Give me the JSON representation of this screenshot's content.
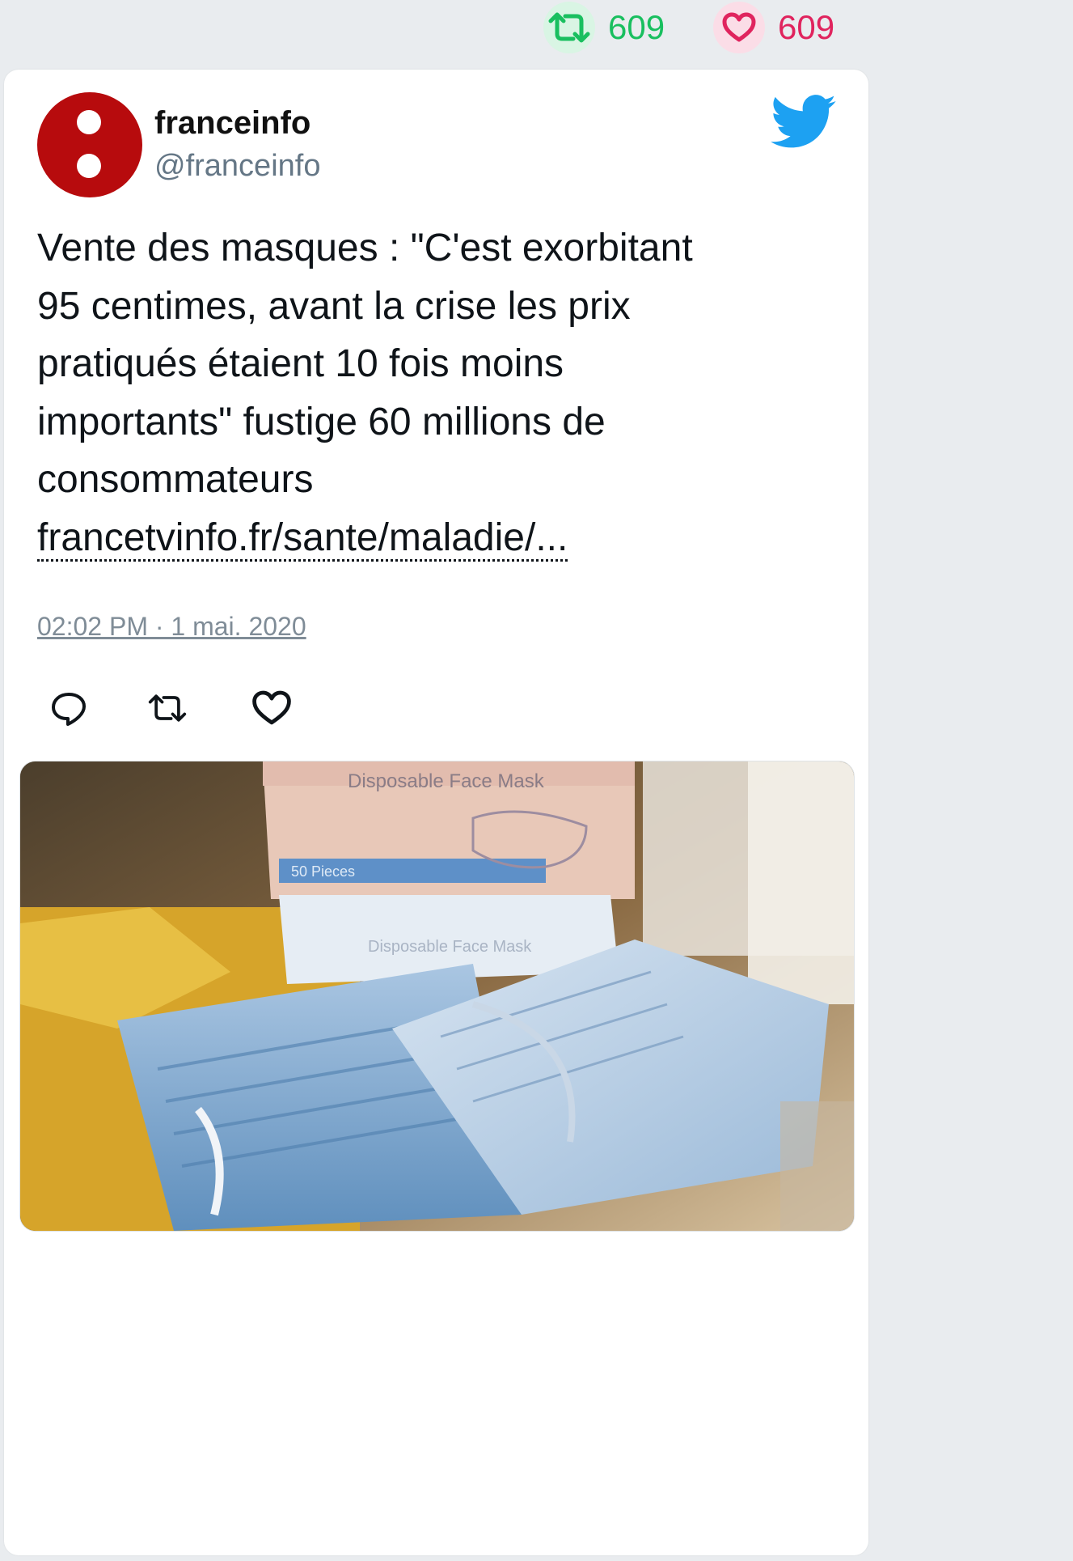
{
  "stats": {
    "retweets": "609",
    "likes": "609",
    "colors": {
      "retweet": "#19bf5f",
      "like": "#e0245e"
    }
  },
  "tweet": {
    "author_name": "franceinfo",
    "author_handle": "@franceinfo",
    "avatar_color": "#b70b0d",
    "text_lines": [
      "Vente des masques : \"C'est exorbitant",
      "95 centimes, avant la crise les prix",
      "pratiqués étaient 10 fois moins",
      "importants\" fustige 60 millions de",
      "consommateurs"
    ],
    "link_text": "francetvinfo.fr/sante/maladie/...",
    "timestamp": "02:02 PM · 1 mai. 2020",
    "icons": {
      "brand": "twitter-bird-icon",
      "reply": "reply-icon",
      "retweet": "retweet-icon",
      "like": "heart-icon"
    },
    "media": {
      "box_label": "Disposable Face Mask",
      "box_sub_label": "50 Pieces",
      "box_label_2": "Disposable Face Mask"
    }
  }
}
